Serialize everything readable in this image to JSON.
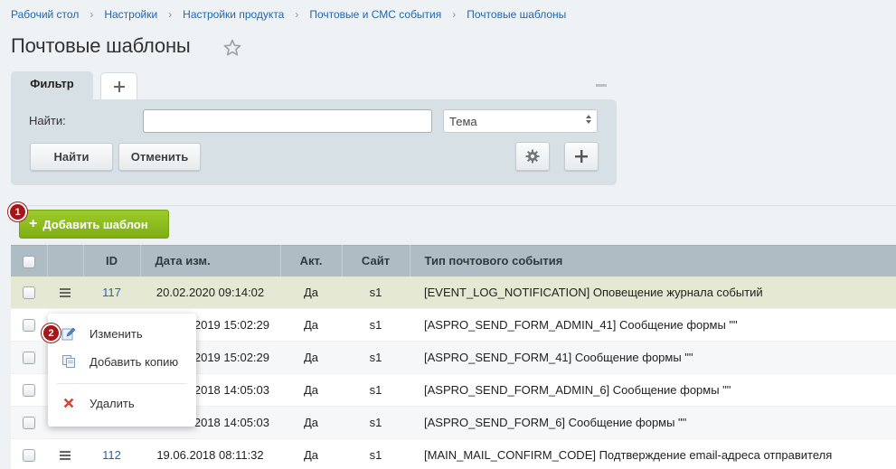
{
  "breadcrumb": {
    "items": [
      "Рабочий стол",
      "Настройки",
      "Настройки продукта",
      "Почтовые и СМС события",
      "Почтовые шаблоны"
    ]
  },
  "page": {
    "title": "Почтовые шаблоны"
  },
  "filter": {
    "tab_label": "Фильтр",
    "add_tab_label": "+",
    "find_label": "Найти:",
    "search_value": "",
    "select_value": "Тема",
    "find_button": "Найти",
    "cancel_button": "Отменить",
    "settings_icon": "gear-icon",
    "add_icon": "plus-icon"
  },
  "toolbar": {
    "add_button": "Добавить шаблон",
    "badge_1": "1",
    "badge_2": "2"
  },
  "table": {
    "columns": [
      "ID",
      "Дата изм.",
      "Акт.",
      "Сайт",
      "Тип почтового события"
    ],
    "rows": [
      {
        "id": "117",
        "date": "20.02.2020 09:14:02",
        "active": "Да",
        "site": "s1",
        "type": "[EVENT_LOG_NOTIFICATION] Оповещение журнала событий"
      },
      {
        "id": "",
        "date": "2019 15:02:29",
        "active": "Да",
        "site": "s1",
        "type": "[ASPRO_SEND_FORM_ADMIN_41] Сообщение формы \"\""
      },
      {
        "id": "",
        "date": "2019 15:02:29",
        "active": "Да",
        "site": "s1",
        "type": "[ASPRO_SEND_FORM_41] Сообщение формы \"\""
      },
      {
        "id": "",
        "date": "2018 14:05:03",
        "active": "Да",
        "site": "s1",
        "type": "[ASPRO_SEND_FORM_ADMIN_6] Сообщение формы \"\""
      },
      {
        "id": "",
        "date": "2018 14:05:03",
        "active": "Да",
        "site": "s1",
        "type": "[ASPRO_SEND_FORM_6] Сообщение формы \"\""
      },
      {
        "id": "112",
        "date": "19.06.2018 08:11:32",
        "active": "Да",
        "site": "s1",
        "type": "[MAIN_MAIL_CONFIRM_CODE] Подтверждение email-адреса отправителя"
      }
    ]
  },
  "context_menu": {
    "edit": "Изменить",
    "copy": "Добавить копию",
    "delete": "Удалить"
  },
  "colors": {
    "accent_green": "#8cbb1e",
    "link_blue": "#2067b0",
    "badge_red": "#a5161a",
    "header_bg": "#aebdc3"
  }
}
